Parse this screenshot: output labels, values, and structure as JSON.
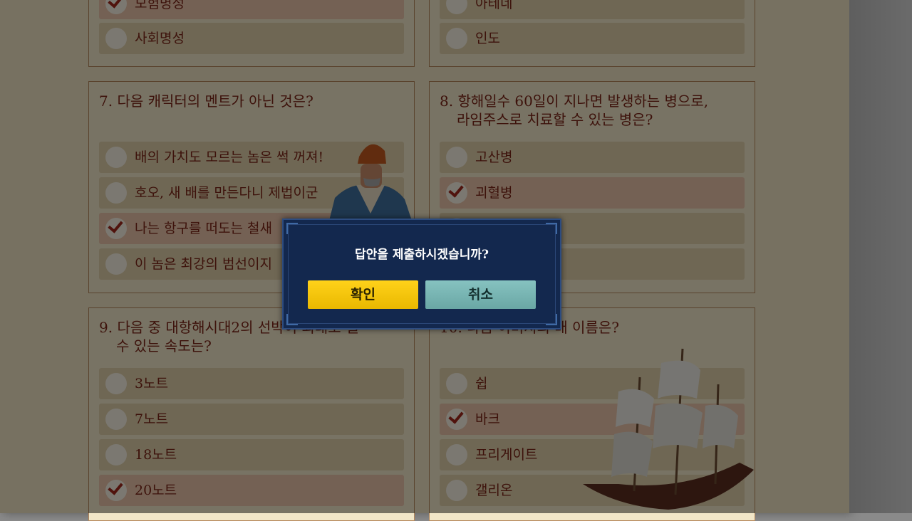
{
  "questions": [
    {
      "title_lines": [],
      "options": [
        {
          "label": "모험명성",
          "selected": true
        },
        {
          "label": "사회명성",
          "selected": false
        }
      ]
    },
    {
      "title_lines": [],
      "options": [
        {
          "label": "아테네",
          "selected": false
        },
        {
          "label": "인도",
          "selected": false
        }
      ]
    },
    {
      "title_lines": [
        "7. 다음 캐릭터의 멘트가 아닌 것은?"
      ],
      "options": [
        {
          "label": "배의 가치도 모르는 놈은 썩 꺼져!",
          "selected": false
        },
        {
          "label": "호오, 새 배를 만든다니 제법이군",
          "selected": false
        },
        {
          "label": "나는 항구를 떠도는 철새",
          "selected": true
        },
        {
          "label": "이 놈은 최강의 범선이지",
          "selected": false
        }
      ]
    },
    {
      "title_lines": [
        "8. 항해일수 60일이 지나면 발생하는 병으로,",
        "라임주스로 치료할 수 있는 병은?"
      ],
      "options": [
        {
          "label": "고산병",
          "selected": false
        },
        {
          "label": "괴혈병",
          "selected": true
        },
        {
          "label": "",
          "selected": false
        },
        {
          "label": "",
          "selected": false
        }
      ]
    },
    {
      "title_lines": [
        "9. 다음 중 대항해시대2의 선박이 최대로 낼",
        "수 있는 속도는?"
      ],
      "options": [
        {
          "label": "3노트",
          "selected": false
        },
        {
          "label": "7노트",
          "selected": false
        },
        {
          "label": "18노트",
          "selected": false
        },
        {
          "label": "20노트",
          "selected": true
        }
      ]
    },
    {
      "title_lines": [
        "10. 다음 이미지의 배 이름은?"
      ],
      "options": [
        {
          "label": "쉽",
          "selected": false
        },
        {
          "label": "바크",
          "selected": true
        },
        {
          "label": "프리게이트",
          "selected": false
        },
        {
          "label": "갤리온",
          "selected": false
        }
      ]
    }
  ],
  "dialog": {
    "message": "답안을 제출하시겠습니까?",
    "confirm_label": "확인",
    "cancel_label": "취소"
  },
  "colors": {
    "accent_text": "#7a2416",
    "confirm_button": "#ffd21a",
    "cancel_button": "#7bb5b3",
    "dialog_bg": "#13284e"
  }
}
